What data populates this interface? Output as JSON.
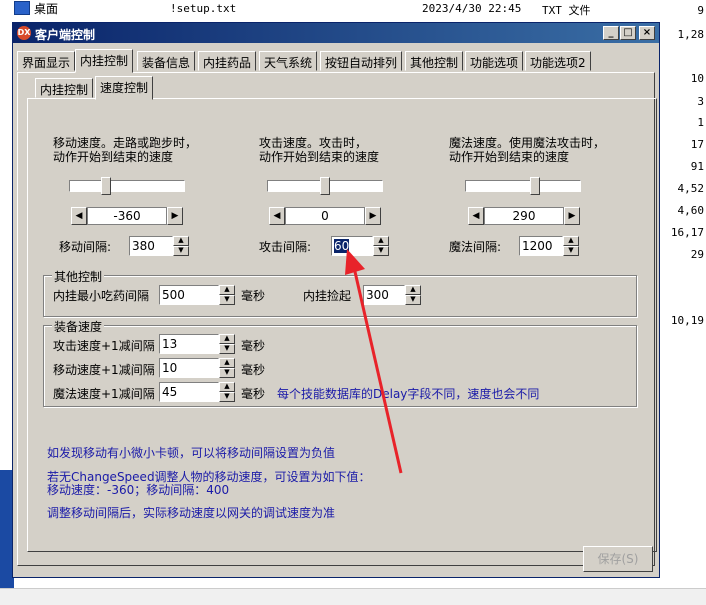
{
  "background": {
    "desktop_label": "桌面",
    "file": {
      "name": "!setup.txt",
      "date": "2023/4/30 22:45",
      "type": "TXT 文件"
    },
    "right_numbers": [
      "9",
      "1,28",
      "10",
      "3",
      "1",
      "17",
      "91",
      "4,52",
      "4,60",
      "16,17",
      "29",
      "10,19"
    ]
  },
  "window": {
    "title": "客户端控制",
    "icon_text": "DX",
    "controls": [
      "_",
      "□",
      "×"
    ]
  },
  "tabs": [
    "界面显示",
    "内挂控制",
    "装备信息",
    "内挂药品",
    "天气系统",
    "按钮自动排列",
    "其他控制",
    "功能选项",
    "功能选项2"
  ],
  "active_tab": 1,
  "subtabs": [
    "内挂控制",
    "速度控制"
  ],
  "active_subtab": 1,
  "speed": {
    "move": {
      "desc1": "移动速度。走路或跑步时，",
      "desc2": "动作开始到结束的速度",
      "value": "-360",
      "interval_label": "移动间隔:",
      "interval": "380",
      "slider_pos": 0.3
    },
    "attack": {
      "desc1": "攻击速度。攻击时，",
      "desc2": "动作开始到结束的速度",
      "value": "0",
      "interval_label": "攻击间隔:",
      "interval": "60",
      "slider_pos": 0.5
    },
    "magic": {
      "desc1": "魔法速度。使用魔法攻击时，",
      "desc2": "动作开始到结束的速度",
      "value": "290",
      "interval_label": "魔法间隔:",
      "interval": "1200",
      "slider_pos": 0.62
    }
  },
  "other_control": {
    "title": "其他控制",
    "potion_label": "内挂最小吃药间隔",
    "potion_value": "500",
    "ms1": "毫秒",
    "pickup_label": "内挂捡起",
    "pickup_value": "300"
  },
  "equip_speed": {
    "title": "装备速度",
    "rows": [
      {
        "label": "攻击速度+1减间隔",
        "value": "13",
        "unit": "毫秒"
      },
      {
        "label": "移动速度+1减间隔",
        "value": "10",
        "unit": "毫秒"
      },
      {
        "label": "魔法速度+1减间隔",
        "value": "45",
        "unit": "毫秒"
      }
    ],
    "note": "每个技能数据库的Delay字段不同，速度也会不同"
  },
  "notes": {
    "line1": "如发现移动有小微小卡顿，可以将移动间隔设置为负值",
    "line2": "若无ChangeSpeed调整人物的移动速度，可设置为如下值：",
    "line3": "移动速度：-360；移动间隔：400",
    "line4": "调整移动间隔后，实际移动速度以网关的调试速度为准"
  },
  "save_button": "保存(S)",
  "colors": {
    "title_bar": "#0a246a",
    "note_text": "#1a1aa8",
    "annotation_arrow": "#e8232a"
  }
}
